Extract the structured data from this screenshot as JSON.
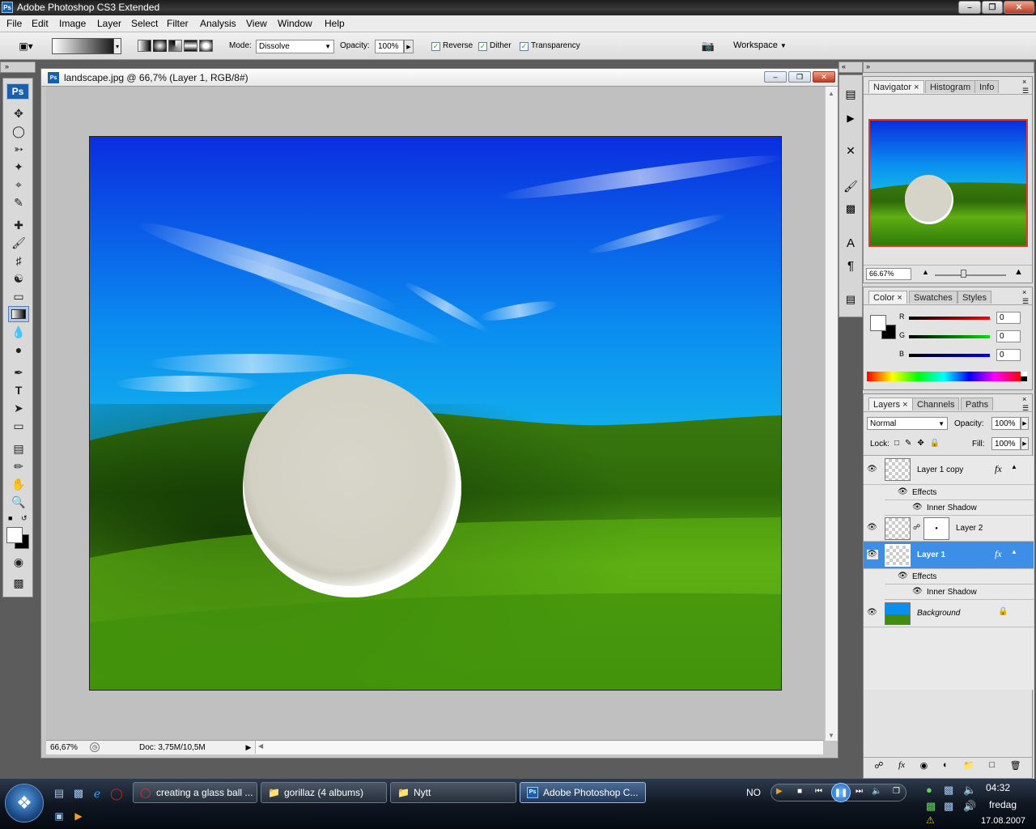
{
  "app": {
    "title": "Adobe Photoshop CS3 Extended",
    "ps_icon": "Ps"
  },
  "menu": [
    "File",
    "Edit",
    "Image",
    "Layer",
    "Select",
    "Filter",
    "Analysis",
    "View",
    "Window",
    "Help"
  ],
  "options": {
    "mode_label": "Mode:",
    "mode_value": "Dissolve",
    "opacity_label": "Opacity:",
    "opacity_value": "100%",
    "reverse_label": "Reverse",
    "dither_label": "Dither",
    "transparency_label": "Transparency",
    "workspace_label": "Workspace"
  },
  "document": {
    "title": "landscape.jpg @ 66,7% (Layer 1, RGB/8#)",
    "zoom": "66,67%",
    "doc_info": "Doc: 3,75M/10,5M"
  },
  "navigator": {
    "tabs": [
      "Navigator",
      "Histogram",
      "Info"
    ],
    "zoom": "66.67%"
  },
  "color_panel": {
    "tabs": [
      "Color",
      "Swatches",
      "Styles"
    ],
    "channels": [
      {
        "label": "R",
        "value": "0",
        "color": "#d42020"
      },
      {
        "label": "G",
        "value": "0",
        "color": "#20c020"
      },
      {
        "label": "B",
        "value": "0",
        "color": "#2020d4"
      }
    ]
  },
  "layers_panel": {
    "tabs": [
      "Layers",
      "Channels",
      "Paths"
    ],
    "blend_mode": "Normal",
    "opacity_label": "Opacity:",
    "opacity_value": "100%",
    "lock_label": "Lock:",
    "fill_label": "Fill:",
    "fill_value": "100%",
    "layers": [
      {
        "name": "Layer 1 copy",
        "effects_label": "Effects",
        "effect": "Inner Shadow",
        "has_fx": true
      },
      {
        "name": "Layer 2",
        "has_mask": true
      },
      {
        "name": "Layer 1",
        "effects_label": "Effects",
        "effect": "Inner Shadow",
        "has_fx": true,
        "selected": true
      },
      {
        "name": "Background",
        "locked": true
      }
    ],
    "fx_symbol": "fx"
  },
  "taskbar": {
    "buttons": [
      {
        "label": "creating a glass ball ..."
      },
      {
        "label": "gorillaz (4 albums)"
      },
      {
        "label": "Nytt"
      },
      {
        "label": "Adobe Photoshop C..."
      }
    ],
    "language": "NO",
    "time": "04:32",
    "day": "fredag",
    "date": "17.08.2007"
  },
  "colors": {
    "selection_blue": "#3d8ee6",
    "photoshop_blue": "#1b5fa8"
  }
}
